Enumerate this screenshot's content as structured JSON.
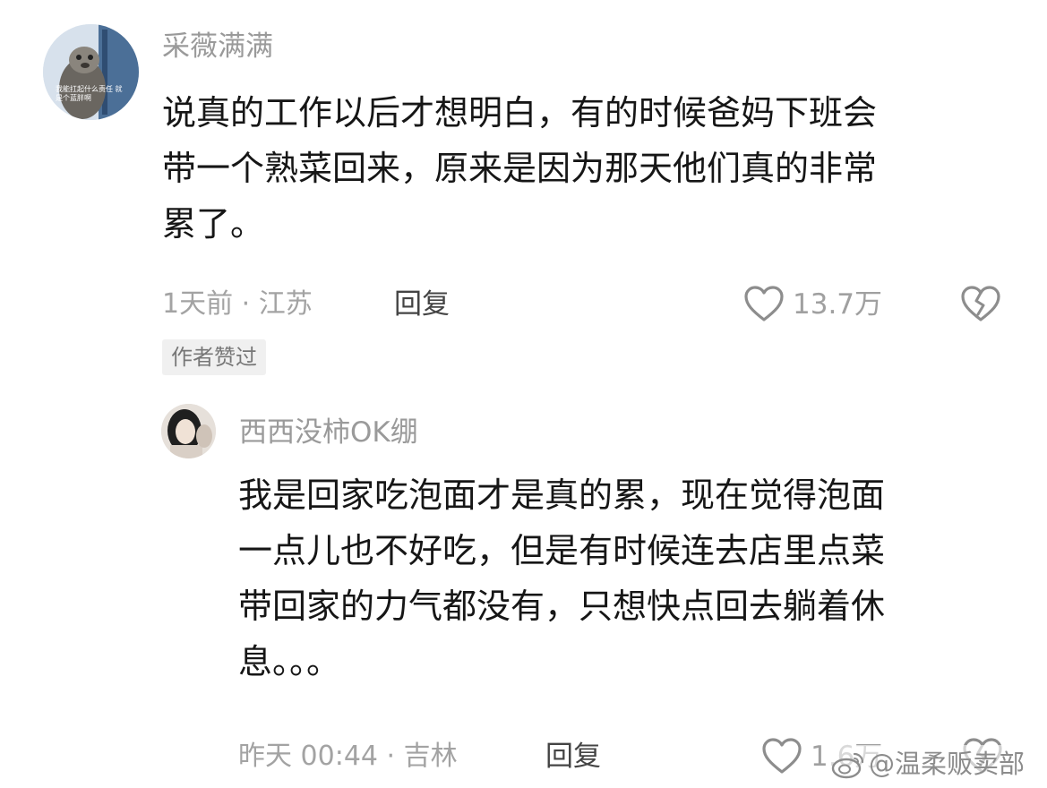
{
  "comment": {
    "avatar_caption": "我能扛起什么责任 就是个蓝胖啊",
    "username": "采薇满满",
    "text_lines": [
      "说真的工作以后才想明白，有的时候爸妈下班会",
      "带一个熟菜回来，原来是因为那天他们真的非常",
      "累了。"
    ],
    "meta": "1天前 · 江苏",
    "reply_label": "回复",
    "like_count": "13.7万",
    "badge": "作者赞过",
    "icons": {
      "like": "heart-outline-icon",
      "dislike": "broken-heart-icon"
    }
  },
  "reply": {
    "username": "西西没柿OK绷",
    "text_lines": [
      "我是回家吃泡面才是真的累，现在觉得泡面",
      "一点儿也不好吃，但是有时候连去店里点菜",
      "带回家的力气都没有，只想快点回去躺着休",
      "息。。。"
    ],
    "meta": "昨天 00:44 · 吉林",
    "reply_label": "回复",
    "like_count": "1.6万",
    "icons": {
      "like": "heart-outline-icon",
      "dislike": "broken-heart-icon"
    }
  },
  "watermark": "@温柔贩卖部"
}
